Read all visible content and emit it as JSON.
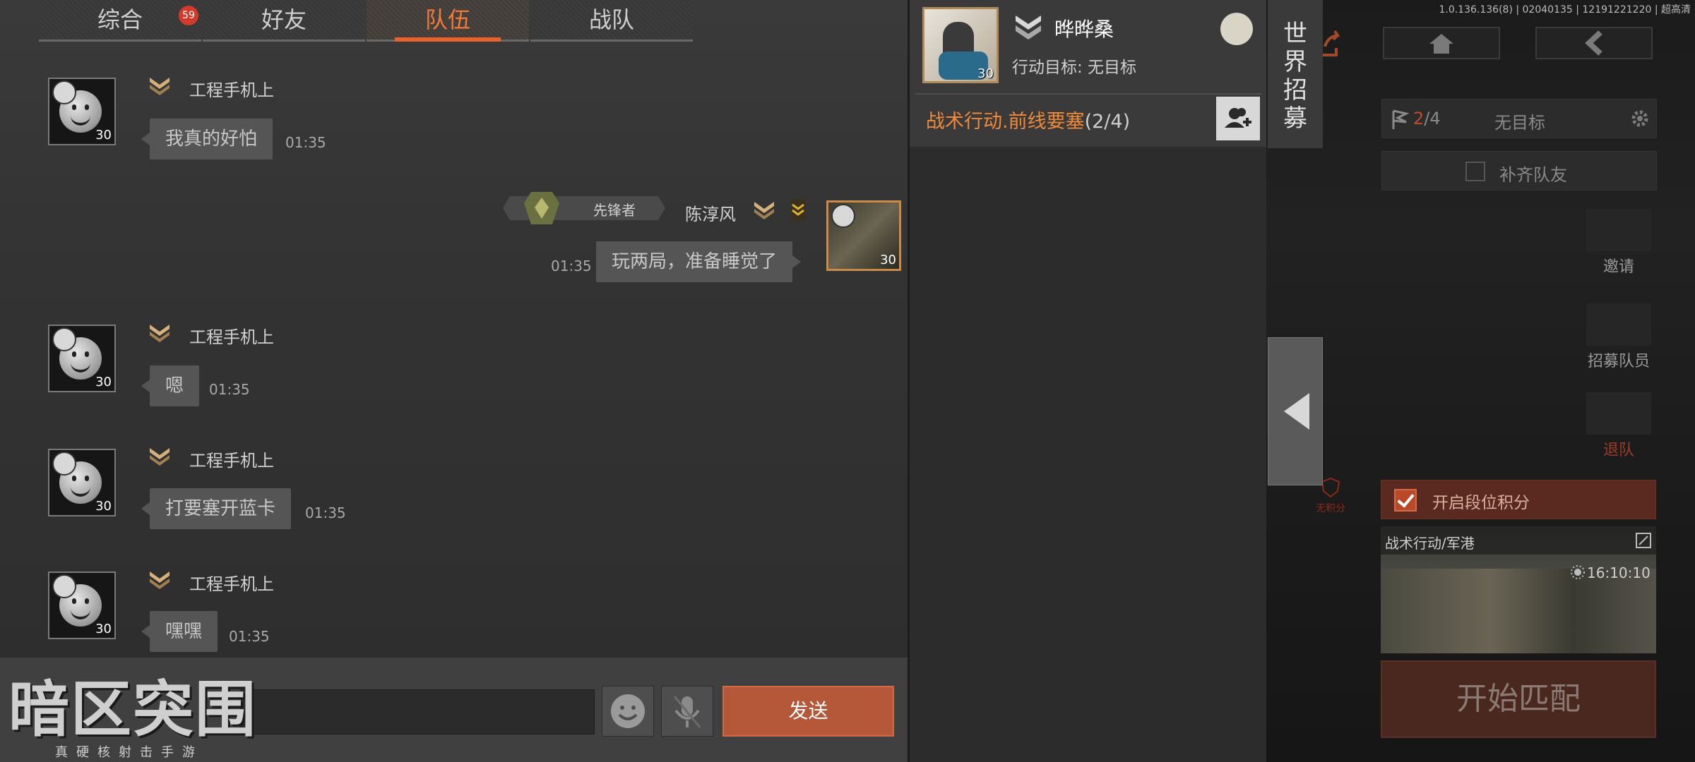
{
  "tabs": [
    {
      "label": "综合",
      "badge": "59"
    },
    {
      "label": "好友"
    },
    {
      "label": "队伍"
    },
    {
      "label": "战队"
    }
  ],
  "messages": [
    {
      "sender": "工程手机上",
      "level": "30",
      "text": "我真的好怕",
      "time": "01:35"
    },
    {
      "sender": "陈淳风",
      "title": "先锋者",
      "level": "30",
      "text": "玩两局，准备睡觉了",
      "time": "01:35"
    },
    {
      "sender": "工程手机上",
      "level": "30",
      "text": "嗯",
      "time": "01:35"
    },
    {
      "sender": "工程手机上",
      "level": "30",
      "text": "打要塞开蓝卡",
      "time": "01:35"
    },
    {
      "sender": "工程手机上",
      "level": "30",
      "text": "嘿嘿",
      "time": "01:35"
    }
  ],
  "input": {
    "placeholder": "",
    "send_label": "发送"
  },
  "logo": {
    "title": "暗区突围",
    "subtitle": "真硬核射击手游"
  },
  "team": {
    "name": "晔晔桑",
    "level": "30",
    "goal": "行动目标: 无目标",
    "mission": "战术行动.前线要塞",
    "count": "(2/4)"
  },
  "recruit_label": "世界招募",
  "right": {
    "version": "1.0.136.136(8) | 02040135 | 12191221220 | 超高清",
    "team_count": "2/4",
    "team_count_cur": "2",
    "team_count_sep": "/4",
    "goal": "无目标",
    "fill_team": "补齐队友",
    "invite": "邀请",
    "recruit_member": "招募队员",
    "leave": "退队",
    "no_score": "无积分",
    "rank_score": "开启段位积分",
    "map": "战术行动/军港",
    "map_time": "16:10:10",
    "start": "开始匹配"
  },
  "colors": {
    "accent": "#e8632a",
    "mission": "#f08a3a",
    "send": "#b5583a"
  }
}
